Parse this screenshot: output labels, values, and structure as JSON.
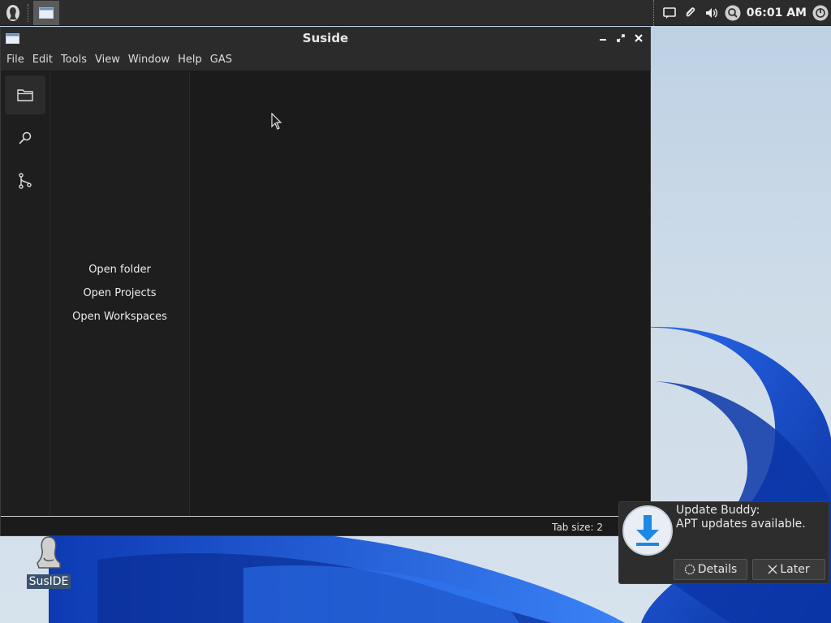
{
  "panel": {
    "clock": "06:01 AM"
  },
  "window": {
    "title": "Suside",
    "menu": [
      "File",
      "Edit",
      "Tools",
      "View",
      "Window",
      "Help",
      "GAS"
    ],
    "sidebar_links": [
      "Open folder",
      "Open Projects",
      "Open Workspaces"
    ],
    "status_tab_size": "Tab size: 2"
  },
  "desktop_icon": {
    "label": "SusIDE"
  },
  "notification": {
    "title": "Update Buddy:",
    "body": "APT updates available.",
    "details_label": "Details",
    "later_label": "Later"
  },
  "colors": {
    "wallpaper_blue": "#1a4fd0",
    "editor_bg": "#1b1b1b",
    "panel_bg": "#2c2c2c",
    "accent": "#1e88e5"
  }
}
